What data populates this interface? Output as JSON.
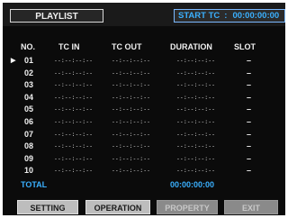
{
  "title": "PLAYLIST",
  "start_tc": {
    "label": "START TC",
    "separator": ":",
    "value": "00:00:00:00"
  },
  "columns": {
    "no": "NO.",
    "tc_in": "TC IN",
    "tc_out": "TC OUT",
    "duration": "DURATION",
    "slot": "SLOT"
  },
  "cursor": "▶",
  "rows": [
    {
      "no": "01",
      "tc_in": "--:--:--:--",
      "tc_out": "--:--:--:--",
      "duration": "--:--:--:--",
      "slot": "–"
    },
    {
      "no": "02",
      "tc_in": "--:--:--:--",
      "tc_out": "--:--:--:--",
      "duration": "--:--:--:--",
      "slot": "–"
    },
    {
      "no": "03",
      "tc_in": "--:--:--:--",
      "tc_out": "--:--:--:--",
      "duration": "--:--:--:--",
      "slot": "–"
    },
    {
      "no": "04",
      "tc_in": "--:--:--:--",
      "tc_out": "--:--:--:--",
      "duration": "--:--:--:--",
      "slot": "–"
    },
    {
      "no": "05",
      "tc_in": "--:--:--:--",
      "tc_out": "--:--:--:--",
      "duration": "--:--:--:--",
      "slot": "–"
    },
    {
      "no": "06",
      "tc_in": "--:--:--:--",
      "tc_out": "--:--:--:--",
      "duration": "--:--:--:--",
      "slot": "–"
    },
    {
      "no": "07",
      "tc_in": "--:--:--:--",
      "tc_out": "--:--:--:--",
      "duration": "--:--:--:--",
      "slot": "–"
    },
    {
      "no": "08",
      "tc_in": "--:--:--:--",
      "tc_out": "--:--:--:--",
      "duration": "--:--:--:--",
      "slot": "–"
    },
    {
      "no": "09",
      "tc_in": "--:--:--:--",
      "tc_out": "--:--:--:--",
      "duration": "--:--:--:--",
      "slot": "–"
    },
    {
      "no": "10",
      "tc_in": "--:--:--:--",
      "tc_out": "--:--:--:--",
      "duration": "--:--:--:--",
      "slot": "–"
    }
  ],
  "total": {
    "label": "TOTAL",
    "value": "00:00:00:00"
  },
  "buttons": {
    "setting": "SETTING",
    "operation": "OPERATION",
    "property": "PROPERTY",
    "exit": "EXIT"
  },
  "colors": {
    "accent": "#3ab0ff",
    "background": "#0b0b0b",
    "text": "#f0f0f0"
  }
}
